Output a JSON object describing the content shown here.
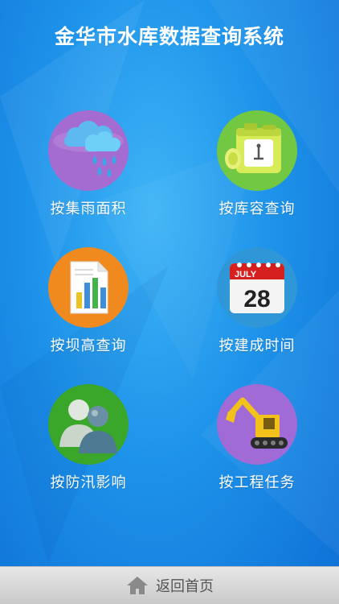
{
  "header": {
    "title": "金华市水库数据查询系统"
  },
  "menu": {
    "items": [
      {
        "label": "按集雨面积",
        "icon": "rain-cloud-icon",
        "color": "#a46bd0"
      },
      {
        "label": "按库容查询",
        "icon": "oil-can-icon",
        "color": "#72c842"
      },
      {
        "label": "按坝高查询",
        "icon": "bar-chart-document-icon",
        "color": "#f08a1e"
      },
      {
        "label": "按建成时间",
        "icon": "calendar-icon",
        "color": "#2f96d8"
      },
      {
        "label": "按防汛影响",
        "icon": "people-icon",
        "color": "#3aa62a"
      },
      {
        "label": "按工程任务",
        "icon": "excavator-icon",
        "color": "#a06bd6"
      }
    ]
  },
  "calendar": {
    "month": "JULY",
    "day": "28"
  },
  "footer": {
    "home_label": "返回首页",
    "icon": "house-icon"
  }
}
